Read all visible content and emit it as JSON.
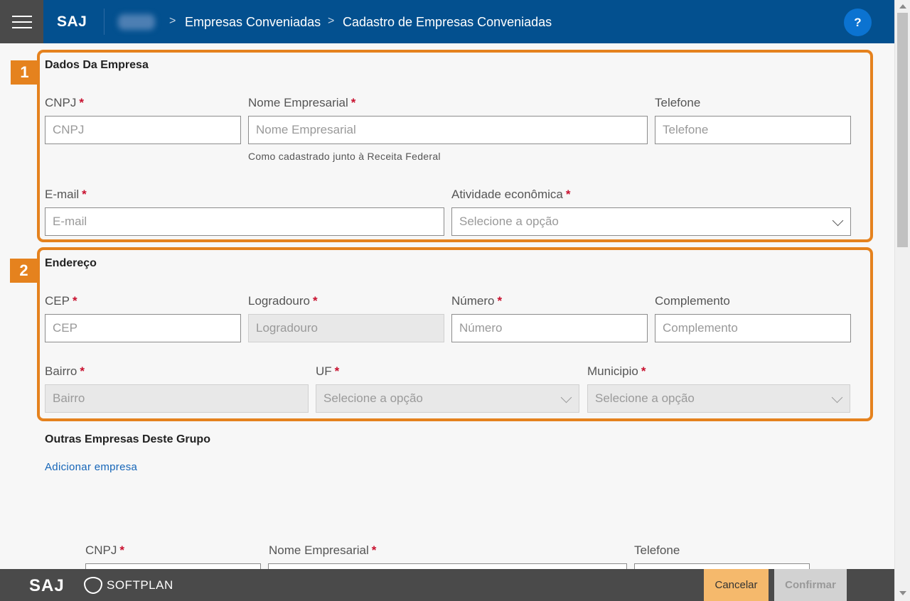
{
  "header": {
    "logo": "SAJ",
    "breadcrumb": [
      "Empresas Conveniadas",
      "Cadastro de Empresas Conveniadas"
    ],
    "breadcrumb_separator": ">",
    "help_label": "?"
  },
  "annotations": {
    "box1_number": "1",
    "box2_number": "2",
    "color": "#e5821e"
  },
  "empresa": {
    "title": "Dados Da Empresa",
    "cnpj": {
      "label": "CNPJ",
      "required": "*",
      "placeholder": "CNPJ"
    },
    "nome": {
      "label": "Nome Empresarial",
      "required": "*",
      "placeholder": "Nome Empresarial",
      "hint": "Como cadastrado junto à Receita Federal"
    },
    "telefone": {
      "label": "Telefone",
      "placeholder": "Telefone"
    },
    "email": {
      "label": "E-mail",
      "required": "*",
      "placeholder": "E-mail"
    },
    "atividade": {
      "label": "Atividade econômica",
      "required": "*",
      "placeholder": "Selecione a opção"
    }
  },
  "endereco": {
    "title": "Endereço",
    "cep": {
      "label": "CEP",
      "required": "*",
      "placeholder": "CEP"
    },
    "logradouro": {
      "label": "Logradouro",
      "required": "*",
      "placeholder": "Logradouro"
    },
    "numero": {
      "label": "Número",
      "required": "*",
      "placeholder": "Número"
    },
    "complemento": {
      "label": "Complemento",
      "placeholder": "Complemento"
    },
    "bairro": {
      "label": "Bairro",
      "required": "*",
      "placeholder": "Bairro"
    },
    "uf": {
      "label": "UF",
      "required": "*",
      "placeholder": "Selecione a opção"
    },
    "municipio": {
      "label": "Municipio",
      "required": "*",
      "placeholder": "Selecione a opção"
    }
  },
  "outras": {
    "title": "Outras Empresas Deste Grupo",
    "add_link": "Adicionar empresa",
    "cnpj_label": "CNPJ",
    "nome_label": "Nome Empresarial",
    "telefone_label": "Telefone",
    "required": "*"
  },
  "footer": {
    "saj": "SAJ",
    "softplan": "SOFTPLAN",
    "cancel": "Cancelar",
    "confirm": "Confirmar",
    "cancel_color": "#f5b96c"
  }
}
